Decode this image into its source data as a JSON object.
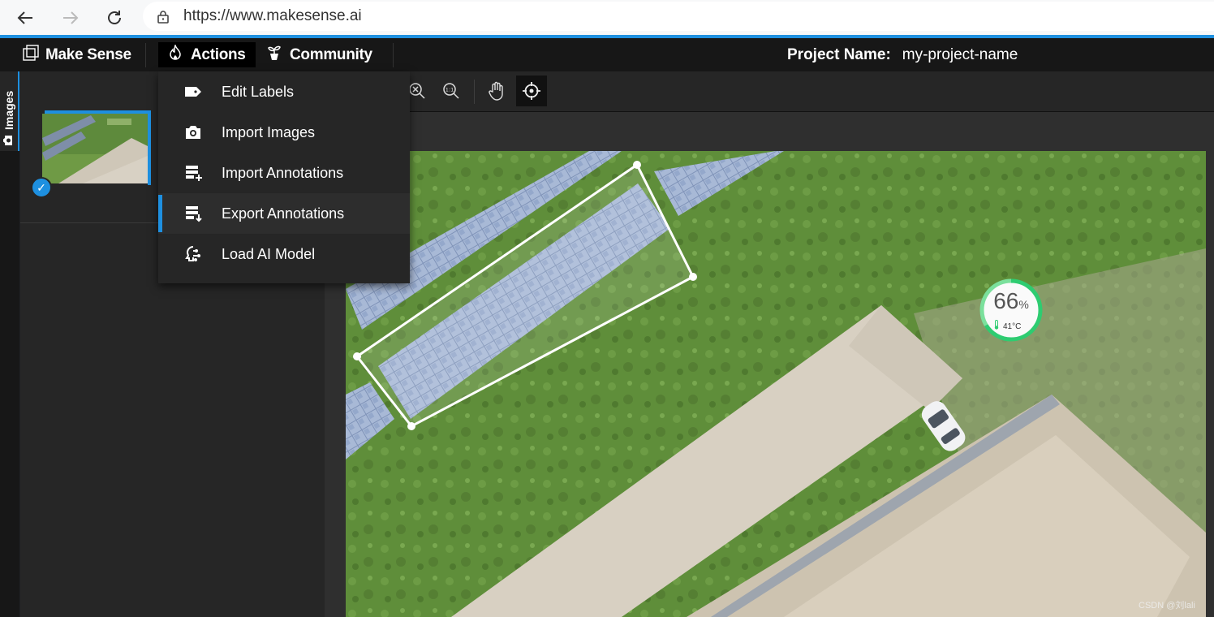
{
  "browser": {
    "url": "https://www.makesense.ai",
    "back_icon": "back-arrow-icon",
    "forward_icon": "forward-arrow-icon",
    "reload_icon": "reload-icon"
  },
  "nav": {
    "brand": "Make Sense",
    "actions": "Actions",
    "community": "Community",
    "project_label": "Project Name:",
    "project_value": "my-project-name"
  },
  "sidebar": {
    "tab_label": "Images"
  },
  "actions_menu": {
    "items": [
      {
        "label": "Edit Labels",
        "icon": "tag-icon"
      },
      {
        "label": "Import Images",
        "icon": "camera-icon"
      },
      {
        "label": "Import Annotations",
        "icon": "list-add-icon"
      },
      {
        "label": "Export Annotations",
        "icon": "list-export-icon",
        "active": true
      },
      {
        "label": "Load AI Model",
        "icon": "ai-brain-icon"
      }
    ]
  },
  "toolbar": {
    "tools": [
      "zoom-fit-icon",
      "zoom-actual-size-icon",
      "hand-pan-icon",
      "crosshair-icon"
    ],
    "active_tool": "crosshair-icon"
  },
  "widget": {
    "percent": "66",
    "percent_unit": "%",
    "temperature": "41°C"
  },
  "watermark": "CSDN @刘lali",
  "colors": {
    "accent": "#1e90e0",
    "topbar": "#171717",
    "panel": "#262626",
    "widget_ring": "#2ecc71"
  }
}
